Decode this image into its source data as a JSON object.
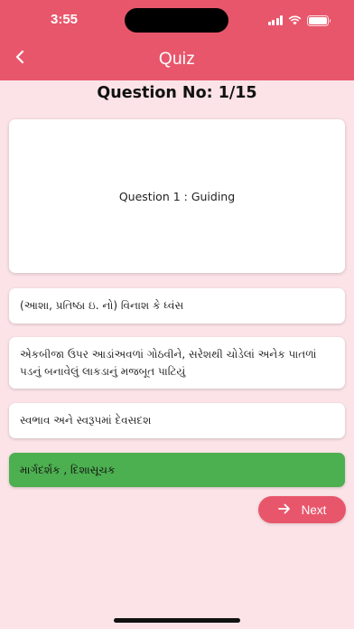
{
  "status_bar": {
    "time": "3:55"
  },
  "app_bar": {
    "title": "Quiz",
    "back_icon": "chevron-left-icon"
  },
  "question_number": "Question No: 1/15",
  "question_text": "Question 1 : Guiding",
  "options": [
    {
      "text": "(આશા, પ્રતિષ્ઠા ઇ. નો) વિનાશ કે ધ્વંસ",
      "selected": false
    },
    {
      "text": "એકબીજા ઉપર આડાંઅવળાં ગોઠવીને, સરેશથી ચોડેલાં અનેક પાતળાં પડનું બનાવેલું લાકડાનું મજબૂત પાટિયું",
      "selected": false
    },
    {
      "text": "સ્વભાવ અને સ્વરૂપમાં દેવસદશ",
      "selected": false
    },
    {
      "text": "માર્ગદર્શક , દિશાસૂચક",
      "selected": true
    }
  ],
  "next_button": {
    "label": "Next",
    "icon": "arrow-right-icon"
  },
  "colors": {
    "primary": "#e8566b",
    "background": "#fbe3e7",
    "selected": "#4caf50"
  }
}
